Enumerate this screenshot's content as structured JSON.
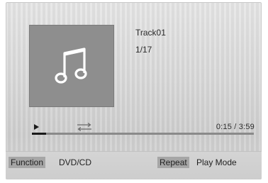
{
  "track": {
    "title": "Track01",
    "position": "1/17",
    "art_icon": "music-note-icon"
  },
  "playback": {
    "state_icon": "play-icon",
    "repeat_icon": "repeat-icon",
    "current_time": "0:15",
    "total_time": "3:59",
    "time_display": "0:15 / 3:59",
    "progress_fraction": 0.0628
  },
  "bottom_bar": {
    "function_label": "Function",
    "function_value": "DVD/CD",
    "repeat_label": "Repeat",
    "repeat_value": "Play Mode"
  },
  "colors": {
    "art_background": "#8e8e8e",
    "progress_played": "#1a1a1a",
    "progress_track": "#8a8a8a",
    "badge_background": "#a6a6a6"
  }
}
